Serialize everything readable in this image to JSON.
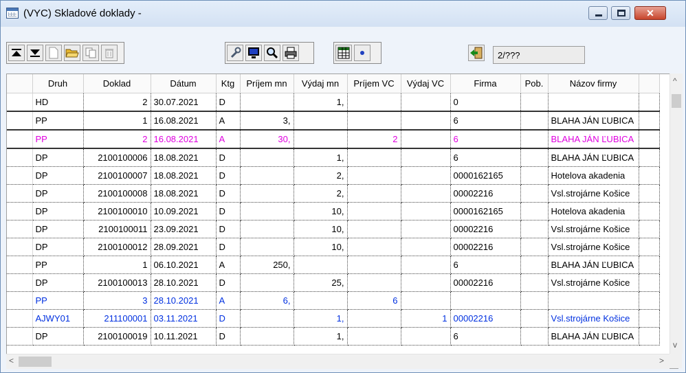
{
  "window": {
    "title": "(VYC) Skladové doklady -",
    "close_glyph": "✕"
  },
  "toolbar": {
    "icons": [
      "move-first-icon",
      "move-last-icon",
      "new-document-icon",
      "open-folder-icon",
      "copy-icon",
      "delete-icon",
      "wrench-icon",
      "monitor-icon",
      "search-icon",
      "print-icon",
      "grid-icon",
      "dot-icon",
      "exit-icon"
    ],
    "record_position": "2/???"
  },
  "grid": {
    "columns": [
      "Druh",
      "Doklad",
      "Dátum",
      "Ktg",
      "Príjem mn",
      "Výdaj mn",
      "Príjem VC",
      "Výdaj VC",
      "Firma",
      "Pob.",
      "Názov firmy"
    ],
    "rows": [
      {
        "cells": [
          "HD",
          "2",
          "30.07.2021",
          "D",
          "",
          "1,",
          "",
          "",
          "0",
          "",
          ""
        ],
        "style": "after-hd"
      },
      {
        "cells": [
          "PP",
          "1",
          "16.08.2021",
          "A",
          "3,",
          "",
          "",
          "",
          "6",
          "",
          "BLAHA JÁN ĽUBICA"
        ],
        "style": ""
      },
      {
        "cells": [
          "PP",
          "2",
          "16.08.2021",
          "A",
          "30,",
          "",
          "2",
          "",
          "6",
          "",
          "BLAHA JÁN ĽUBICA"
        ],
        "style": "magenta current"
      },
      {
        "cells": [
          "DP",
          "2100100006",
          "18.08.2021",
          "D",
          "",
          "1,",
          "",
          "",
          "6",
          "",
          "BLAHA JÁN ĽUBICA"
        ],
        "style": ""
      },
      {
        "cells": [
          "DP",
          "2100100007",
          "18.08.2021",
          "D",
          "",
          "2,",
          "",
          "",
          "0000162165",
          "",
          "Hotelova akadenia"
        ],
        "style": ""
      },
      {
        "cells": [
          "DP",
          "2100100008",
          "18.08.2021",
          "D",
          "",
          "2,",
          "",
          "",
          "00002216",
          "",
          "Vsl.strojárne Košice"
        ],
        "style": ""
      },
      {
        "cells": [
          "DP",
          "2100100010",
          "10.09.2021",
          "D",
          "",
          "10,",
          "",
          "",
          "0000162165",
          "",
          "Hotelova akadenia"
        ],
        "style": ""
      },
      {
        "cells": [
          "DP",
          "2100100011",
          "23.09.2021",
          "D",
          "",
          "10,",
          "",
          "",
          "00002216",
          "",
          "Vsl.strojárne Košice"
        ],
        "style": ""
      },
      {
        "cells": [
          "DP",
          "2100100012",
          "28.09.2021",
          "D",
          "",
          "10,",
          "",
          "",
          "00002216",
          "",
          "Vsl.strojárne Košice"
        ],
        "style": ""
      },
      {
        "cells": [
          "PP",
          "1",
          "06.10.2021",
          "A",
          "250,",
          "",
          "",
          "",
          "6",
          "",
          "BLAHA JÁN ĽUBICA"
        ],
        "style": ""
      },
      {
        "cells": [
          "DP",
          "2100100013",
          "28.10.2021",
          "D",
          "",
          "25,",
          "",
          "",
          "00002216",
          "",
          "Vsl.strojárne Košice"
        ],
        "style": ""
      },
      {
        "cells": [
          "PP",
          "3",
          "28.10.2021",
          "A",
          "6,",
          "",
          "6",
          "",
          "",
          "",
          ""
        ],
        "style": "blue"
      },
      {
        "cells": [
          "AJWY01",
          "211100001",
          "03.11.2021",
          "D",
          "",
          "1,",
          "",
          "1",
          "00002216",
          "",
          "Vsl.strojárne Košice"
        ],
        "style": "blue"
      },
      {
        "cells": [
          "DP",
          "2100100019",
          "10.11.2021",
          "D",
          "",
          "1,",
          "",
          "",
          "6",
          "",
          "BLAHA JÁN ĽUBICA"
        ],
        "style": ""
      }
    ]
  },
  "scrollbar": {
    "up": "^",
    "down": "v",
    "left": "<",
    "right": ">"
  },
  "colors": {
    "magenta_row": "#e000e0",
    "blue_row": "#0030e0",
    "close_button": "#c7452c"
  }
}
